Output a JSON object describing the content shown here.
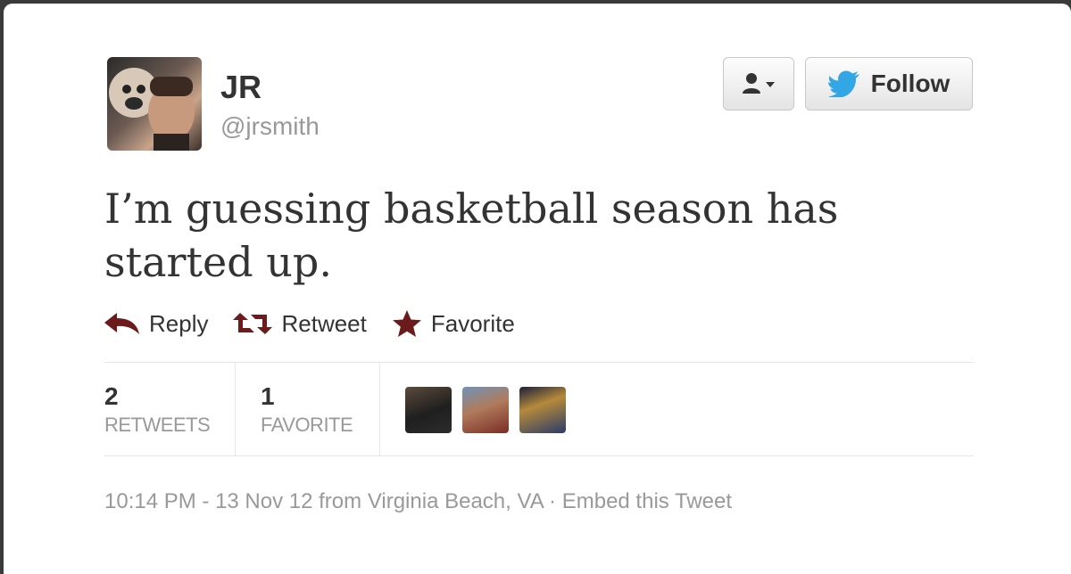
{
  "user": {
    "name": "JR",
    "handle": "@jrsmith"
  },
  "buttons": {
    "follow_label": "Follow"
  },
  "tweet": {
    "text": "I’m guessing basketball season has started up."
  },
  "actions": {
    "reply": "Reply",
    "retweet": "Retweet",
    "favorite": "Favorite"
  },
  "stats": {
    "retweets_count": "2",
    "retweets_label": "RETWEETS",
    "favorites_count": "1",
    "favorites_label": "FAVORITE"
  },
  "meta": {
    "time": "10:14 PM",
    "separator1": " - ",
    "date": "13 Nov 12",
    "from": " from ",
    "location": "Virginia Beach, VA",
    "separator2": " · ",
    "embed": "Embed this Tweet"
  },
  "colors": {
    "action_icon": "#6b1b1b",
    "twitter_blue": "#33a6e6",
    "meta_gray": "#999999"
  },
  "icons": [
    "user-icon",
    "chevron-down-icon",
    "twitter-bird-icon",
    "reply-icon",
    "retweet-icon",
    "star-icon"
  ]
}
